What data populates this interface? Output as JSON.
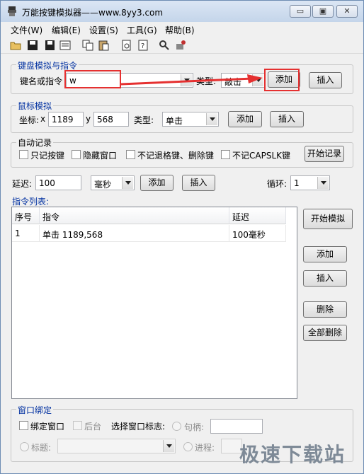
{
  "window": {
    "title": "万能按键模拟器——www.8yy3.com",
    "buttons": {
      "minimize": "▭",
      "maximize": "▣",
      "close": "✕"
    }
  },
  "menu": [
    "文件(W)",
    "编辑(E)",
    "设置(S)",
    "工具(G)",
    "帮助(B)"
  ],
  "toolbar": [
    "open-folder-icon",
    "save-icon",
    "save-all-icon",
    "properties-icon",
    "copy-icon",
    "paste-icon",
    "print-preview-icon",
    "help-icon",
    "find-icon",
    "record-icon"
  ],
  "keyboard": {
    "group_label": "键盘模拟与指令",
    "key_label": "键名或指令",
    "key_value": "w",
    "type_label": "类型:",
    "type_value": "敲击",
    "add": "添加",
    "insert": "插入"
  },
  "mouse": {
    "group_label": "鼠标模拟",
    "coord_label": "坐标:",
    "x_label": "x",
    "x_value": "1189",
    "y_label": "y",
    "y_value": "568",
    "type_label": "类型:",
    "type_value": "单击",
    "add": "添加",
    "insert": "插入"
  },
  "autorecord": {
    "group_label": "自动记录",
    "opt1": "只记按键",
    "opt2": "隐藏窗口",
    "opt3": "不记退格键、删除键",
    "opt4": "不记CAPSLK键",
    "start": "开始记录"
  },
  "delay": {
    "label": "延迟:",
    "value": "100",
    "unit": "毫秒",
    "add": "添加",
    "insert": "插入",
    "loop_label": "循环:",
    "loop_value": "1"
  },
  "list": {
    "label": "指令列表:",
    "columns": [
      "序号",
      "指令",
      "延迟"
    ],
    "rows": [
      {
        "no": "1",
        "cmd": "单击 1189,568",
        "delay": "100毫秒"
      }
    ]
  },
  "side": {
    "start_sim": "开始模拟",
    "add": "添加",
    "insert": "插入",
    "delete": "删除",
    "delete_all": "全部删除"
  },
  "bind": {
    "group_label": "窗口绑定",
    "bind_window": "绑定窗口",
    "background": "后台",
    "select_label": "选择窗口标志:",
    "handle_label": "句柄:",
    "title_label": "标题:",
    "process_label": "进程:"
  },
  "watermark": "极速下载站",
  "colors": {
    "accent_blue": "#0030a0",
    "annotation_red": "#e53030"
  }
}
